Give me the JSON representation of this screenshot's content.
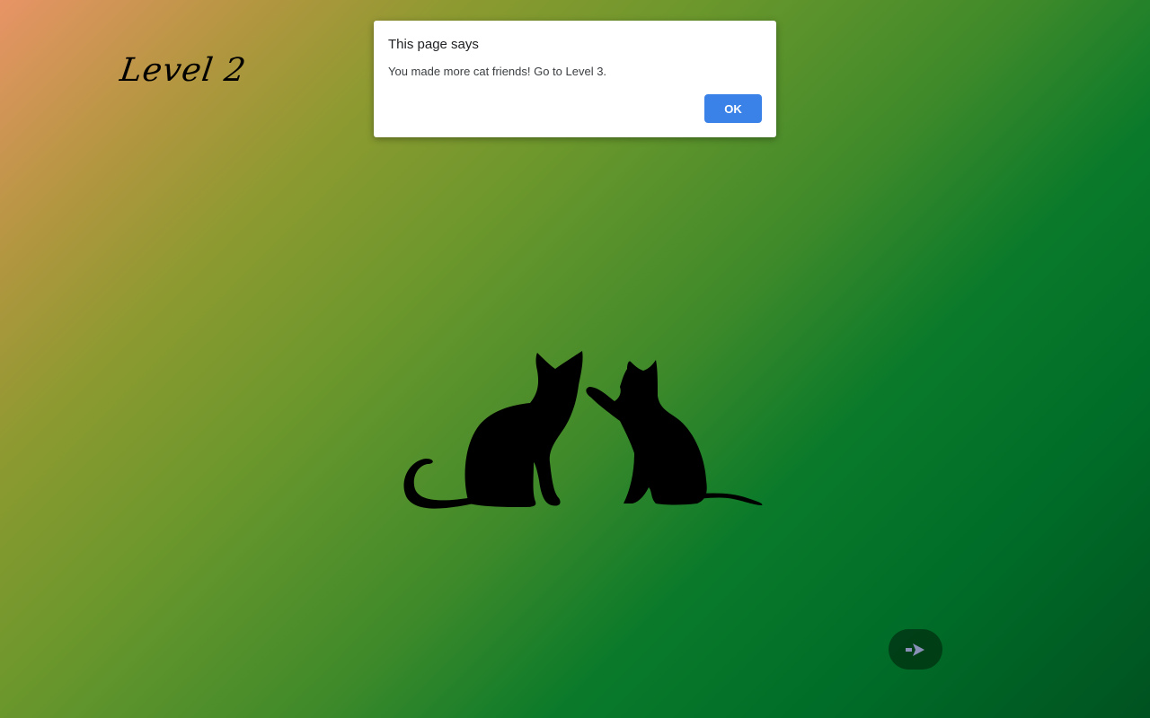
{
  "game": {
    "level_title": "Level 2"
  },
  "scene": {
    "characters": [
      "cat-silhouette-sitting",
      "cat-silhouette-pawing"
    ]
  },
  "controls": {
    "next_icon": "arrow-right-icon",
    "next_icon_color": "#8a8fb8"
  },
  "alert": {
    "title": "This page says",
    "message": "You made more cat friends! Go to Level 3.",
    "ok_label": "OK",
    "ok_color": "#3b82e8"
  }
}
